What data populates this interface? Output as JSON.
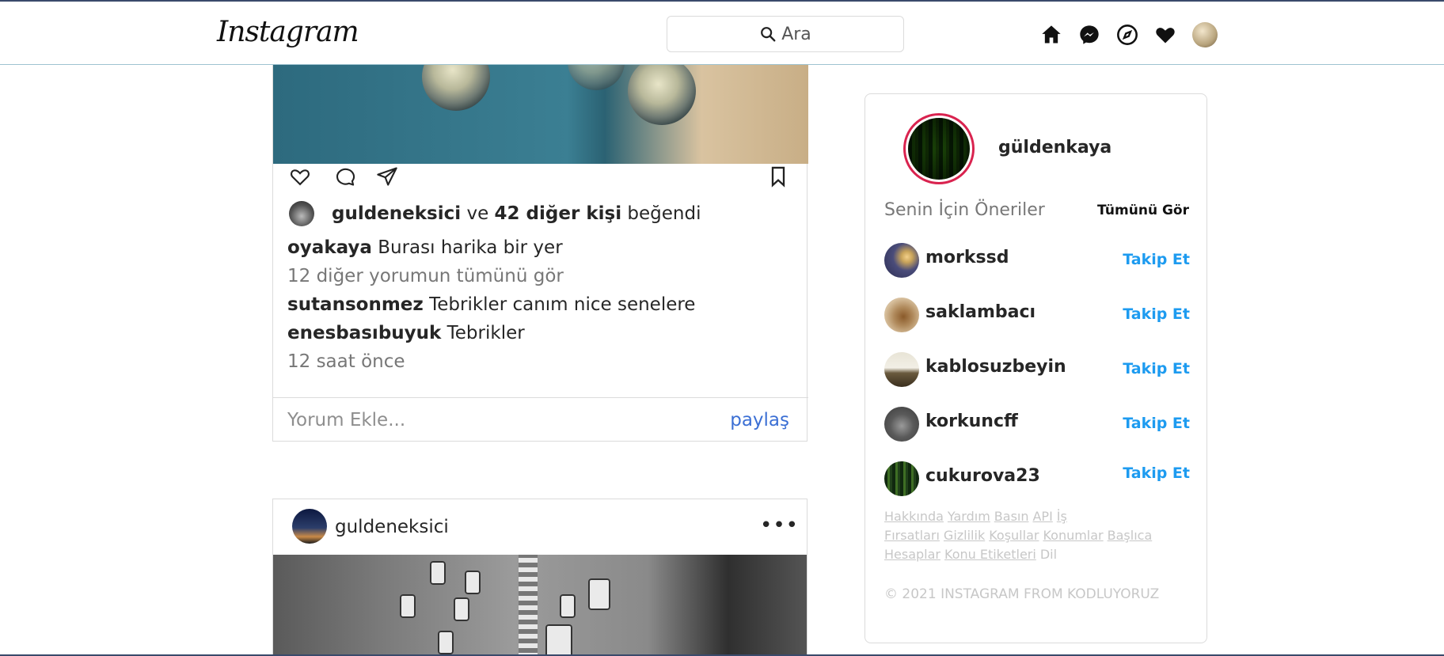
{
  "header": {
    "logo": "Instagram",
    "search_placeholder": "Ara",
    "icons": [
      "home-icon",
      "messenger-icon",
      "explore-icon",
      "heart-icon",
      "profile-avatar"
    ]
  },
  "post1": {
    "liked_by_user": "guldeneksici",
    "liked_and": "ve",
    "liked_others": "42 diğer kişi",
    "liked_suffix": "beğendi",
    "comments": [
      {
        "user": "oyakaya",
        "text": "Burası harika bir yer"
      },
      {
        "user": "sutansonmez",
        "text": "Tebrikler canım nice senelere"
      },
      {
        "user": "enesbasıbuyuk",
        "text": "Tebrikler"
      }
    ],
    "view_all": "12 diğer yorumun tümünü gör",
    "time": "12 saat önce",
    "add_comment_placeholder": "Yorum Ekle...",
    "share_label": "paylaş"
  },
  "post2": {
    "user": "guldeneksici",
    "more": "•••"
  },
  "sidebar": {
    "me": "güldenkaya",
    "suggestions_title": "Senin İçin Öneriler",
    "see_all": "Tümünü Gör",
    "follow_label": "Takip Et",
    "suggestions": [
      {
        "name": "morkssd"
      },
      {
        "name": "saklambacı"
      },
      {
        "name": "kablosuzbeyin"
      },
      {
        "name": "korkuncff"
      },
      {
        "name": "cukurova23"
      }
    ],
    "footer_links": [
      "Hakkında",
      "Yardım",
      "Basın",
      "API",
      "İş Fırsatları",
      "Gizlilik",
      "Koşullar",
      "Konumlar",
      "Başlıca Hesaplar",
      "Konu Etiketleri",
      "Dil"
    ],
    "copyright": "© 2021 INSTAGRAM FROM KODLUYORUZ"
  },
  "colors": {
    "accent_blue": "#1d9bf0",
    "share_blue": "#3b6fd4",
    "story_ring": "#d9234f"
  }
}
